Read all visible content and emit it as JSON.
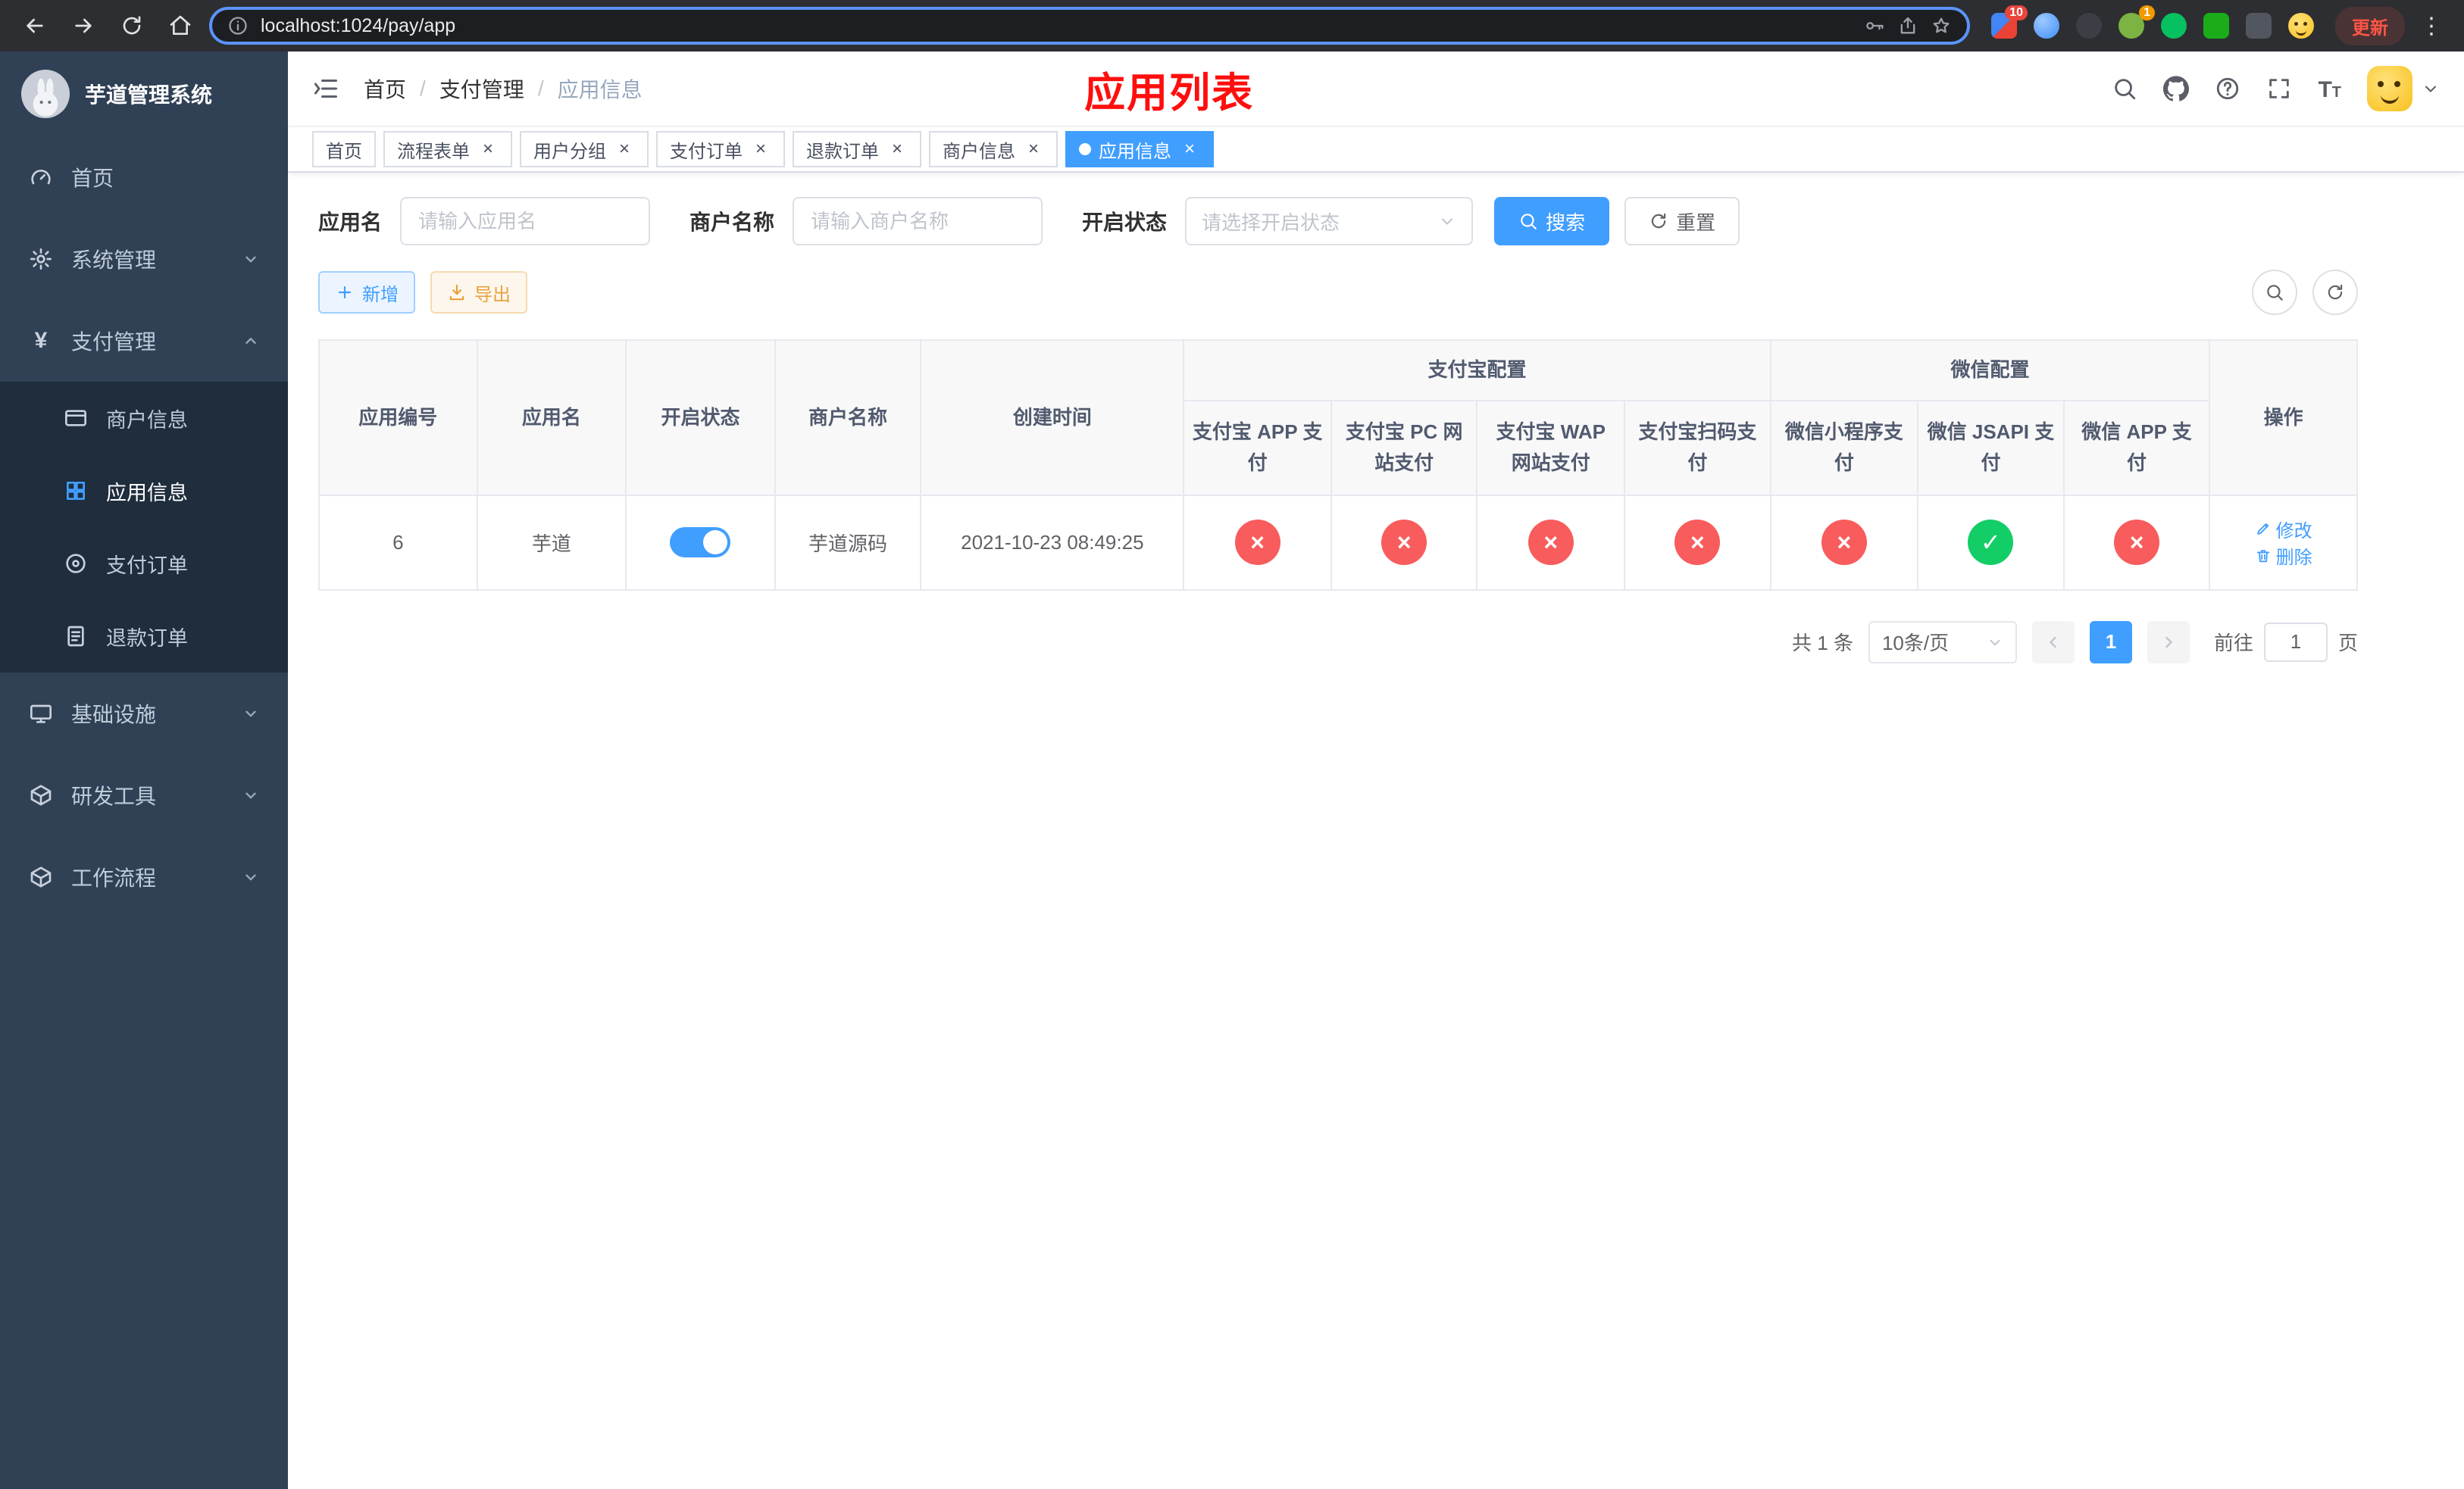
{
  "browser": {
    "url": "localhost:1024/pay/app",
    "update_button": "更新",
    "extension_badge_count": "10",
    "wallet_badge_count": "1"
  },
  "sidebar": {
    "logo_title": "芋道管理系统",
    "home": "首页",
    "system_mgmt": "系统管理",
    "payment_mgmt": "支付管理",
    "merchant_info": "商户信息",
    "app_info": "应用信息",
    "payment_order": "支付订单",
    "refund_order": "退款订单",
    "infrastructure": "基础设施",
    "dev_tools": "研发工具",
    "workflow": "工作流程"
  },
  "header": {
    "breadcrumb_home": "首页",
    "breadcrumb_section": "支付管理",
    "breadcrumb_current": "应用信息",
    "page_title": "应用列表"
  },
  "tabs": [
    {
      "label": "首页"
    },
    {
      "label": "流程表单"
    },
    {
      "label": "用户分组"
    },
    {
      "label": "支付订单"
    },
    {
      "label": "退款订单"
    },
    {
      "label": "商户信息"
    },
    {
      "label": "应用信息"
    }
  ],
  "filters": {
    "app_name_label": "应用名",
    "app_name_placeholder": "请输入应用名",
    "merchant_label": "商户名称",
    "merchant_placeholder": "请输入商户名称",
    "status_label": "开启状态",
    "status_placeholder": "请选择开启状态",
    "search_button": "搜索",
    "reset_button": "重置"
  },
  "toolbar": {
    "add_button": "新增",
    "export_button": "导出"
  },
  "table": {
    "columns": {
      "app_id": "应用编号",
      "app_name": "应用名",
      "status": "开启状态",
      "merchant": "商户名称",
      "created": "创建时间",
      "alipay_group": "支付宝配置",
      "wechat_group": "微信配置",
      "alipay_app": "支付宝 APP 支付",
      "alipay_pc": "支付宝 PC 网站支付",
      "alipay_wap": "支付宝 WAP 网站支付",
      "alipay_qr": "支付宝扫码支付",
      "wx_mini": "微信小程序支付",
      "wx_jsapi": "微信 JSAPI 支付",
      "wx_app": "微信 APP 支付",
      "actions": "操作"
    },
    "row": {
      "app_id": "6",
      "app_name": "芋道",
      "status_on": true,
      "merchant_name": "芋道源码",
      "created_at": "2021-10-23 08:49:25",
      "channels_enabled": [
        false,
        false,
        false,
        false,
        false,
        true,
        false
      ],
      "edit_label": "修改",
      "delete_label": "删除"
    }
  },
  "pagination": {
    "total_text": "共 1 条",
    "page_size_text": "10条/页",
    "current_page": "1",
    "goto_prefix": "前往",
    "goto_value": "1",
    "goto_suffix": "页"
  }
}
